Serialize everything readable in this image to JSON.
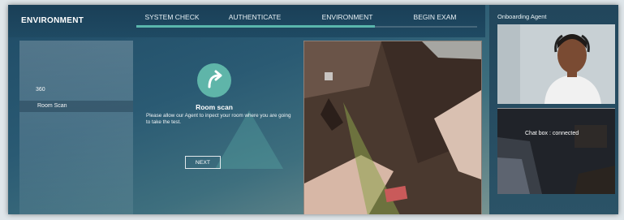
{
  "header": {
    "title": "ENVIRONMENT",
    "steps": [
      {
        "label": "SYSTEM CHECK"
      },
      {
        "label": "AUTHENTICATE"
      },
      {
        "label": "ENVIRONMENT"
      },
      {
        "label": "BEGIN EXAM"
      }
    ],
    "progress_percent": 70
  },
  "sidebar": {
    "items": [
      {
        "label": "360"
      },
      {
        "label": "Room Scan",
        "selected": true
      }
    ]
  },
  "main": {
    "icon": "rotate-arrow-icon",
    "title": "Room scan",
    "description": "Please allow our Agent to inpect your room where you are going to take the test.",
    "next_label": "NEXT"
  },
  "agent": {
    "title": "Onboarding Agent",
    "chat_status": "Chat box : connected"
  },
  "colors": {
    "accent": "#5fb5a9",
    "header_bg": "#1a3f57"
  }
}
